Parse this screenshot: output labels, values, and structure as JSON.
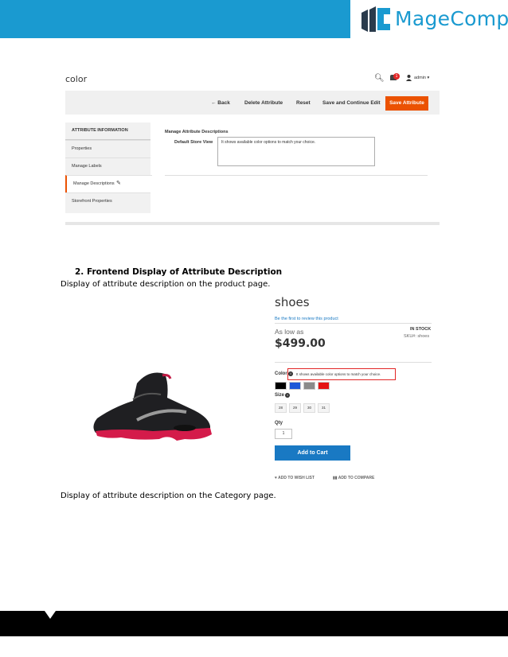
{
  "brand": {
    "logo_text": "MageComp",
    "color": "#1a9ad0"
  },
  "admin": {
    "page_title": "color",
    "user_label": "admin ▾",
    "notification_count": "1",
    "toolbar": {
      "back": "← Back",
      "delete": "Delete Attribute",
      "reset": "Reset",
      "save_continue": "Save and Continue Edit",
      "save": "Save Attribute"
    },
    "tabs": {
      "header": "ATTRIBUTE INFORMATION",
      "properties": "Properties",
      "labels": "Manage Labels",
      "descriptions": "Manage Descriptions",
      "storefront": "Storefront Properties"
    },
    "section_title": "Manage Attribute Descriptions",
    "store_view_label": "Default Store View",
    "description_value": "It shows available color options to match your choice.",
    "accent_color": "#eb5202"
  },
  "doc": {
    "heading": "2.   Frontend Display of Attribute Description",
    "product_page_text": "Display of attribute description on the product page.",
    "category_page_text": "Display of attribute description on the Category page."
  },
  "product": {
    "name": "shoes",
    "review_link": "Be the first to review this product",
    "as_low_as": "As low as",
    "price": "$499.00",
    "stock": "IN STOCK",
    "sku": "SKU#:   shoes",
    "color_label": "Color",
    "color_tooltip": "It shows available color options to match your choice.",
    "swatches": [
      "#000000",
      "#1e57d8",
      "#8a8a8a",
      "#e51313"
    ],
    "size_label": "Size",
    "sizes": [
      "28",
      "29",
      "30",
      "31"
    ],
    "qty_label": "Qty",
    "qty_value": "1",
    "add_to_cart": "Add to Cart",
    "wishlist": "♥ ADD TO WISH LIST",
    "compare": "▮▮ ADD TO COMPARE",
    "button_color": "#1979c3"
  }
}
